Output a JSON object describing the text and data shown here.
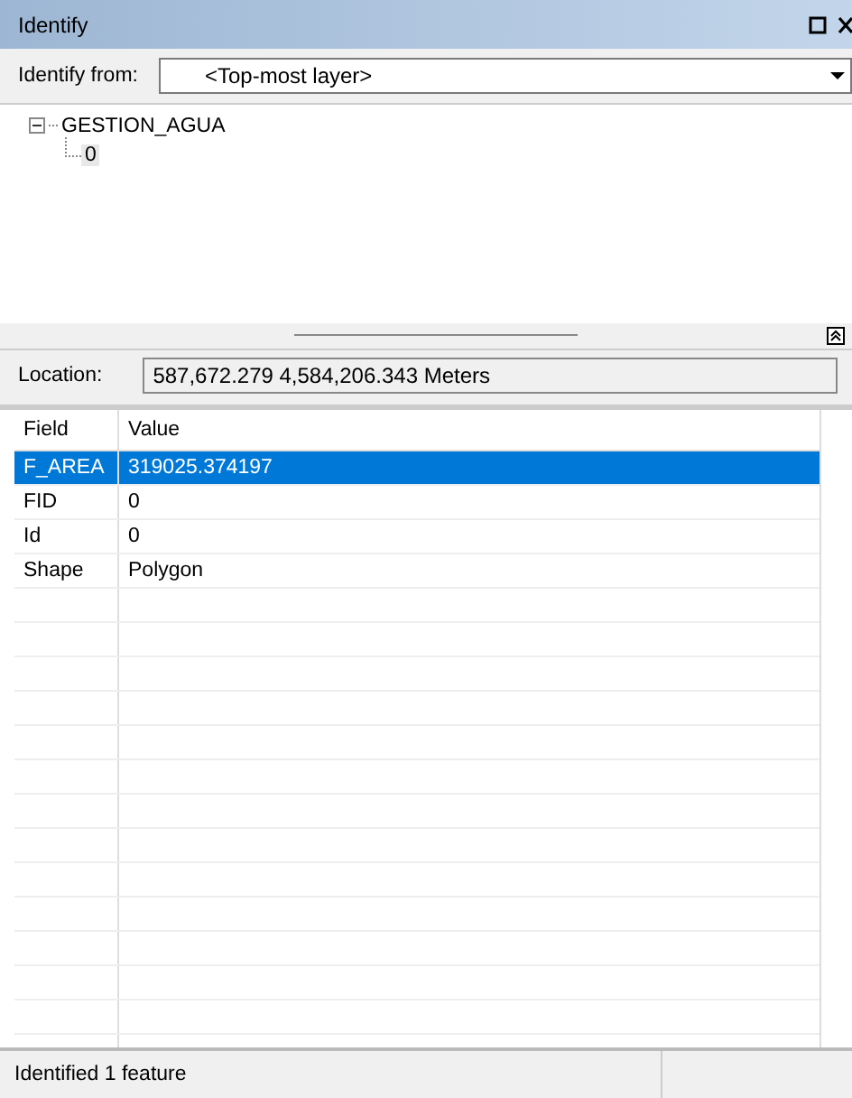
{
  "window": {
    "title": "Identify"
  },
  "identify_from": {
    "label": "Identify from:",
    "value": "<Top-most layer>"
  },
  "tree": [
    {
      "label": "GESTION_AGUA",
      "expanded": true,
      "children": [
        {
          "label": "0"
        }
      ]
    }
  ],
  "location": {
    "label": "Location:",
    "value": "587,672.279  4,584,206.343 Meters"
  },
  "table": {
    "columns": [
      "Field",
      "Value"
    ],
    "rows": [
      {
        "cells": [
          "F_AREA",
          "319025.374197"
        ],
        "selected": true
      },
      {
        "cells": [
          "FID",
          "0"
        ],
        "selected": false
      },
      {
        "cells": [
          "Id",
          "0"
        ],
        "selected": false
      },
      {
        "cells": [
          "Shape",
          "Polygon"
        ],
        "selected": false
      }
    ]
  },
  "status_bar": "Identified 1 feature"
}
